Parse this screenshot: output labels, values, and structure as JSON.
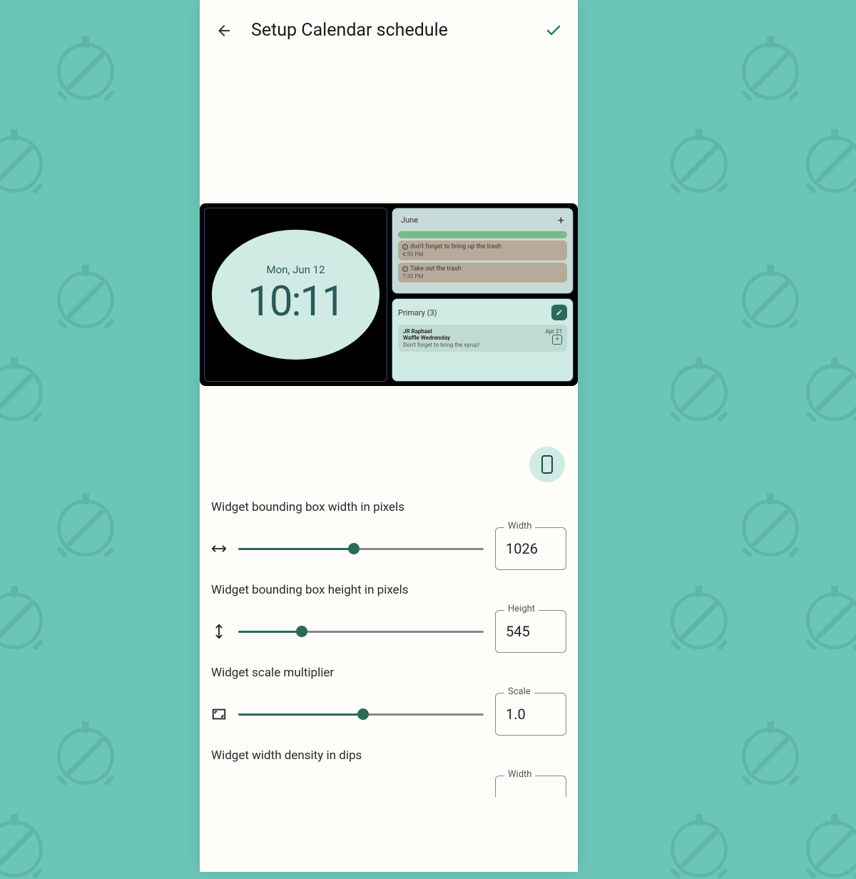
{
  "header": {
    "title": "Setup Calendar schedule"
  },
  "preview": {
    "clock": {
      "date": "Mon, Jun 12",
      "time": "10:11"
    },
    "calendar": {
      "month": "June",
      "items": [
        {
          "title": "don't forget to bring up the trash",
          "time": "4:50 PM"
        },
        {
          "title": "Take out the trash",
          "time": "7:30 PM"
        }
      ]
    },
    "mail": {
      "label": "Primary (3)",
      "from": "JR Raphael",
      "date": "Apr 21",
      "subject": "Waffle Wednesday",
      "preview": "Don't forget to bring the syrup!"
    }
  },
  "controls": {
    "width": {
      "label": "Widget bounding box width in pixels",
      "box_label": "Width",
      "value": "1026",
      "pct": 47
    },
    "height": {
      "label": "Widget bounding box height in pixels",
      "box_label": "Height",
      "value": "545",
      "pct": 26
    },
    "scale": {
      "label": "Widget scale multiplier",
      "box_label": "Scale",
      "value": "1.0",
      "pct": 51
    },
    "density": {
      "label": "Widget width density in dips",
      "box_label": "Width"
    }
  }
}
